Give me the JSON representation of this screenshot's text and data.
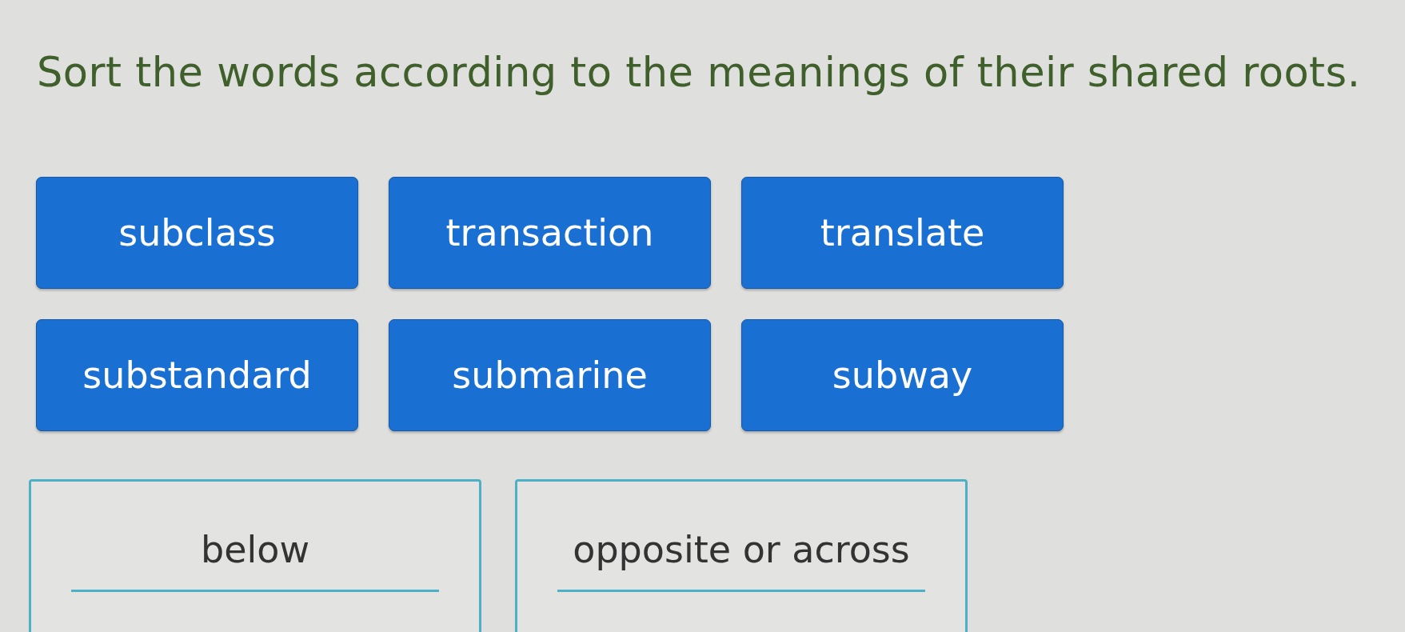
{
  "instruction": "Sort the words according to the meanings of their shared roots.",
  "word_tiles": [
    {
      "text": "subclass"
    },
    {
      "text": "transaction"
    },
    {
      "text": "translate"
    },
    {
      "text": "substandard"
    },
    {
      "text": "submarine"
    },
    {
      "text": "subway"
    }
  ],
  "categories": [
    {
      "label": "below"
    },
    {
      "label": "opposite or across"
    }
  ]
}
